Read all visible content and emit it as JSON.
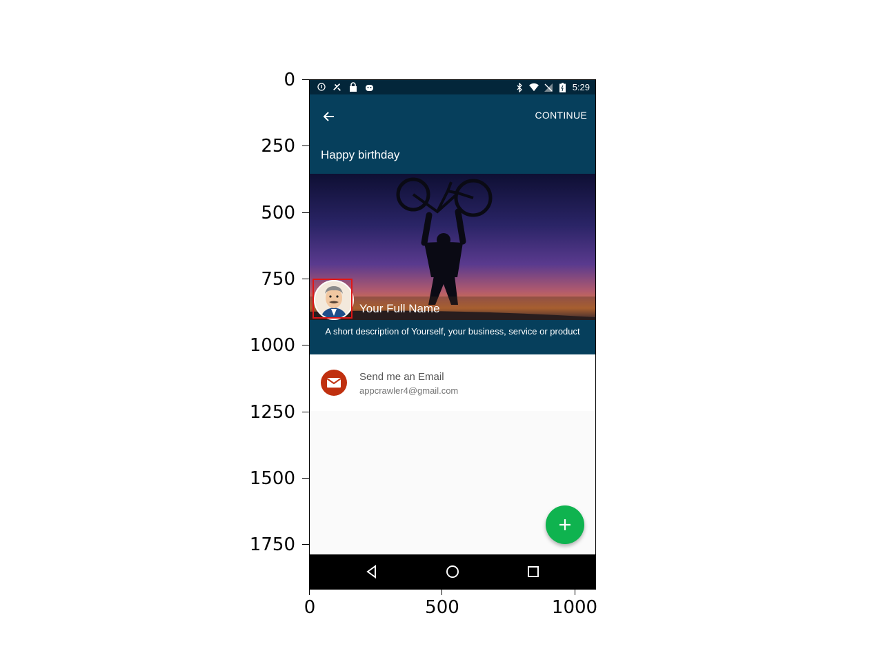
{
  "axes": {
    "y_ticks": [
      "0",
      "250",
      "500",
      "750",
      "1000",
      "1250",
      "1500",
      "1750"
    ],
    "x_ticks": [
      "0",
      "500",
      "1000"
    ]
  },
  "status_bar": {
    "time": "5:29",
    "left_icons": [
      "info-icon",
      "satellite-icon",
      "lock-icon",
      "android-icon"
    ],
    "right_icons": [
      "bluetooth-icon",
      "wifi-icon",
      "no-signal-icon",
      "battery-icon"
    ]
  },
  "app_bar": {
    "continue_label": "CONTINUE",
    "title": "Happy birthday",
    "color": "#063f5c"
  },
  "profile": {
    "name": "Your Full Name",
    "description": "A short description of Yourself, your business, service or product"
  },
  "contact": {
    "title": "Send me an Email",
    "email": "appcrawler4@gmail.com",
    "icon_color": "#c0300f"
  },
  "fab": {
    "color": "#0fb34f",
    "symbol": "+"
  }
}
